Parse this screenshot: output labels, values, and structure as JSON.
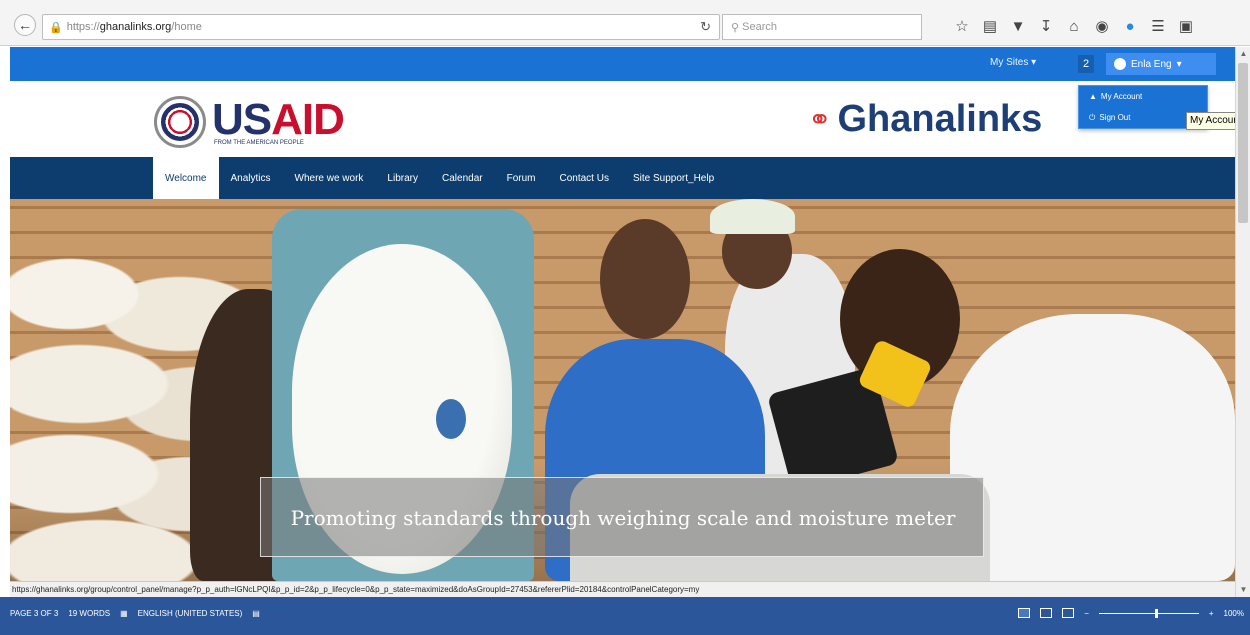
{
  "browser": {
    "url_prefix": "https://",
    "url_host": "ghanalinks.org",
    "url_path": "/home",
    "search_placeholder": "Search"
  },
  "dockbar": {
    "my_sites": "My Sites",
    "notification_count": "2",
    "user_name": "Enla Eng"
  },
  "user_menu": {
    "items": [
      {
        "label": "My Account"
      },
      {
        "label": "Sign Out"
      }
    ],
    "tooltip": "My Account"
  },
  "header": {
    "usaid_us": "US",
    "usaid_aid": "AID",
    "usaid_tagline": "FROM THE AMERICAN PEOPLE",
    "brand": "Ghanalinks"
  },
  "nav": {
    "items": [
      {
        "label": "Welcome",
        "active": true
      },
      {
        "label": "Analytics"
      },
      {
        "label": "Where we work"
      },
      {
        "label": "Library"
      },
      {
        "label": "Calendar"
      },
      {
        "label": "Forum"
      },
      {
        "label": "Contact Us"
      },
      {
        "label": "Site Support_Help"
      }
    ]
  },
  "hero": {
    "caption": "Promoting standards through weighing scale and moisture meter"
  },
  "status_link": "https://ghanalinks.org/group/control_panel/manage?p_p_auth=lGNcLPQI&p_p_id=2&p_p_lifecycle=0&p_p_state=maximized&doAsGroupId=27453&refererPlid=20184&controlPanelCategory=my",
  "word_status": {
    "page": "PAGE 3 OF 3",
    "words": "19 WORDS",
    "language": "ENGLISH (UNITED STATES)",
    "zoom": "100%"
  }
}
